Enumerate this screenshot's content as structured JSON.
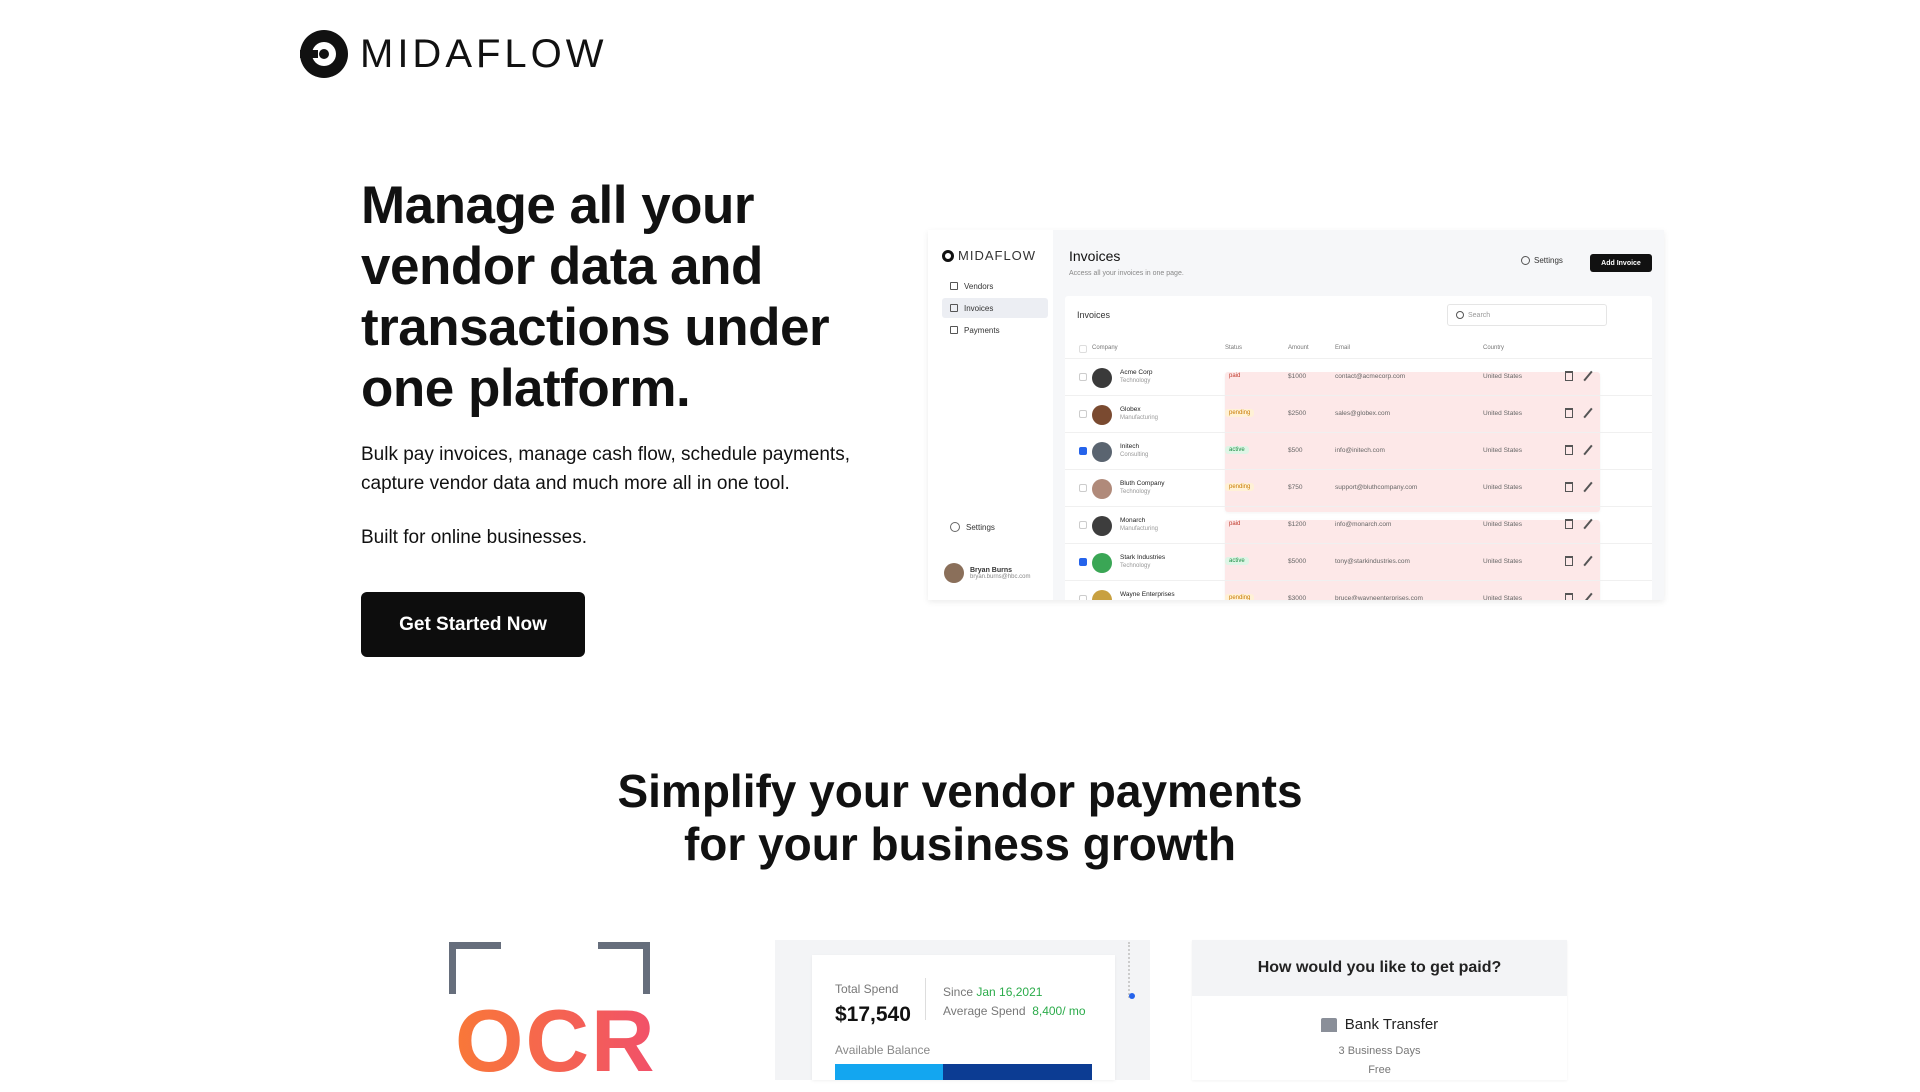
{
  "brand": {
    "name_bold": "MIDA",
    "name_rest": "FLOW"
  },
  "hero": {
    "title": "Manage all your vendor data and transactions under one platform.",
    "subtitle": "Bulk pay invoices, manage cash flow, schedule payments, capture vendor data and much more all in one tool.",
    "built_for": "Built for online businesses.",
    "cta": "Get Started Now"
  },
  "app": {
    "logo": "MIDAFLOW",
    "nav": [
      "Vendors",
      "Invoices",
      "Payments"
    ],
    "active_nav": "Invoices",
    "settings": "Settings",
    "user": {
      "name": "Bryan Burns",
      "email": "bryan.burns@hbc.com"
    },
    "page_title": "Invoices",
    "page_sub": "Access all your invoices in one page.",
    "settings_btn": "Settings",
    "add_btn": "Add Invoice",
    "card_title": "Invoices",
    "search_placeholder": "Search",
    "columns": [
      "Company",
      "Status",
      "Amount",
      "Email",
      "Country"
    ],
    "rows": [
      {
        "company": "Acme Corp",
        "industry": "Technology",
        "status": "paid",
        "amount": "$1000",
        "email": "contact@acmecorp.com",
        "country": "United States",
        "checked": false
      },
      {
        "company": "Globex",
        "industry": "Manufacturing",
        "status": "pending",
        "amount": "$2500",
        "email": "sales@globex.com",
        "country": "United States",
        "checked": false
      },
      {
        "company": "Initech",
        "industry": "Consulting",
        "status": "active",
        "amount": "$500",
        "email": "info@initech.com",
        "country": "United States",
        "checked": true
      },
      {
        "company": "Bluth Company",
        "industry": "Technology",
        "status": "pending",
        "amount": "$750",
        "email": "support@bluthcompany.com",
        "country": "United States",
        "checked": false
      },
      {
        "company": "Monarch",
        "industry": "Manufacturing",
        "status": "paid",
        "amount": "$1200",
        "email": "info@monarch.com",
        "country": "United States",
        "checked": false
      },
      {
        "company": "Stark Industries",
        "industry": "Technology",
        "status": "active",
        "amount": "$5000",
        "email": "tony@starkindustries.com",
        "country": "United States",
        "checked": true
      },
      {
        "company": "Wayne Enterprises",
        "industry": "",
        "status": "pending",
        "amount": "$3000",
        "email": "bruce@wayneenterprises.com",
        "country": "United States",
        "checked": false
      }
    ]
  },
  "section2": {
    "line1": "Simplify your vendor payments",
    "line2": "for your business growth"
  },
  "ocr": {
    "label": "OCR"
  },
  "spend": {
    "total_label": "Total Spend",
    "total_value": "$17,540",
    "since_label": "Since",
    "since_date": "Jan 16,2021",
    "avg_label": "Average Spend",
    "avg_value": "8,400/ mo",
    "balance_label": "Available Balance"
  },
  "paid": {
    "question": "How would you like to get paid?",
    "method": "Bank Transfer",
    "days": "3 Business Days",
    "fee": "Free"
  }
}
